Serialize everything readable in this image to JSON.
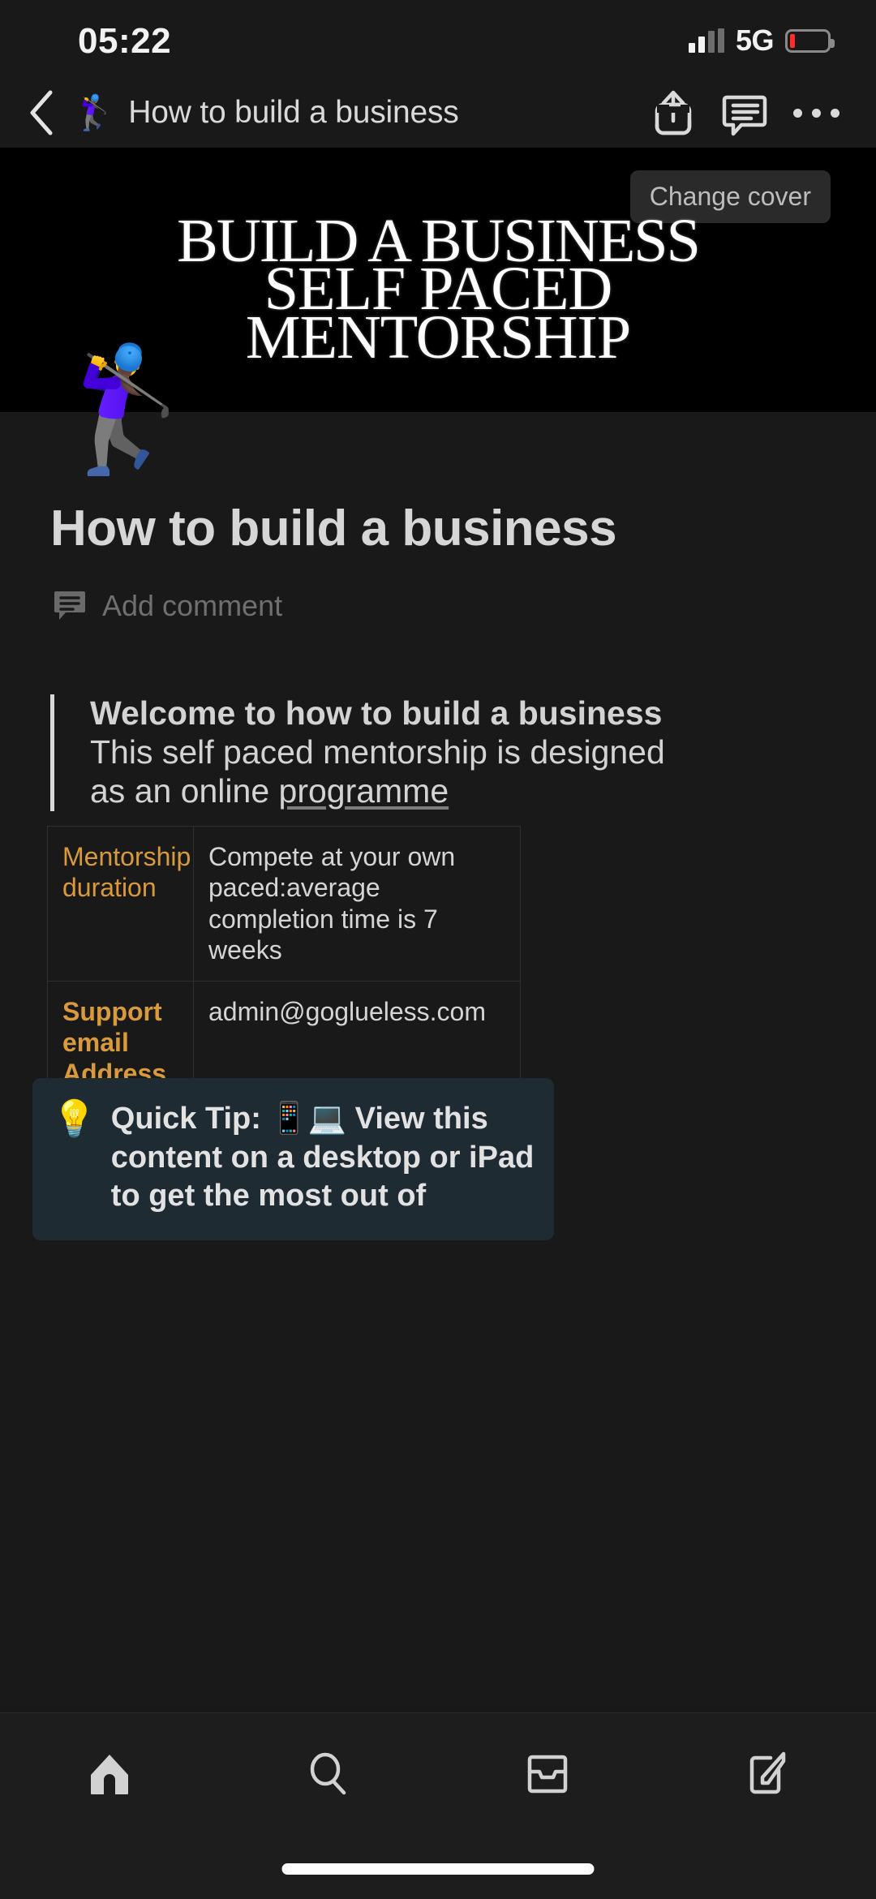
{
  "status_bar": {
    "time": "05:22",
    "network": "5G",
    "signal_icon": "cellular-signal-icon",
    "battery_icon": "battery-low-icon"
  },
  "nav_bar": {
    "back_icon": "chevron-left-icon",
    "page_emoji": "🏌️‍♀️",
    "title": "How to build a business",
    "actions": [
      {
        "name": "share-button",
        "icon": "share-icon"
      },
      {
        "name": "comment-button",
        "icon": "comment-icon"
      },
      {
        "name": "more-options-button",
        "icon": "ellipsis-icon"
      }
    ]
  },
  "cover": {
    "change_cover_label": "Change cover",
    "title_line1": "BUILD A BUSINESS",
    "title_line2": "SELF PACED",
    "title_line3": "MENTORSHIP"
  },
  "page": {
    "icon_emoji": "🏌️‍♀️",
    "title": "How to build a business",
    "add_comment_label": "Add comment",
    "comment_icon": "comment-icon",
    "quote": {
      "line1": "Welcome to how to build a business",
      "line2": "This self paced mentorship is designed",
      "line3_prefix": "as an online ",
      "line3_link": "programme"
    },
    "table": {
      "rows": [
        {
          "key": "Mentorship duration",
          "key_bold": false,
          "value": "Compete at your own paced:average completion time is 7 weeks"
        },
        {
          "key": "Support email Address and telegram",
          "key_bold": true,
          "value": "admin@goglueless.com"
        }
      ]
    },
    "callout": {
      "bulb_emoji": "💡",
      "text_part1": "Quick Tip: ",
      "phone_emoji": "📱",
      "laptop_emoji": "💻",
      "text_part2": " View this content on a desktop or iPad to get the most out of"
    }
  },
  "tab_bar": {
    "tabs": [
      {
        "name": "tab-home",
        "icon": "home-icon",
        "selected": true
      },
      {
        "name": "tab-search",
        "icon": "search-icon",
        "selected": false
      },
      {
        "name": "tab-inbox",
        "icon": "inbox-icon",
        "selected": false
      },
      {
        "name": "tab-new-note",
        "icon": "compose-icon",
        "selected": false
      }
    ],
    "home_indicator": "home-indicator"
  },
  "colors": {
    "background": "#191919",
    "cover_background": "#000000",
    "accent_orange": "#d99a3c",
    "callout_background": "#1f2b33",
    "text_primary": "#d6d6d6",
    "text_muted": "#6f6f6f"
  }
}
